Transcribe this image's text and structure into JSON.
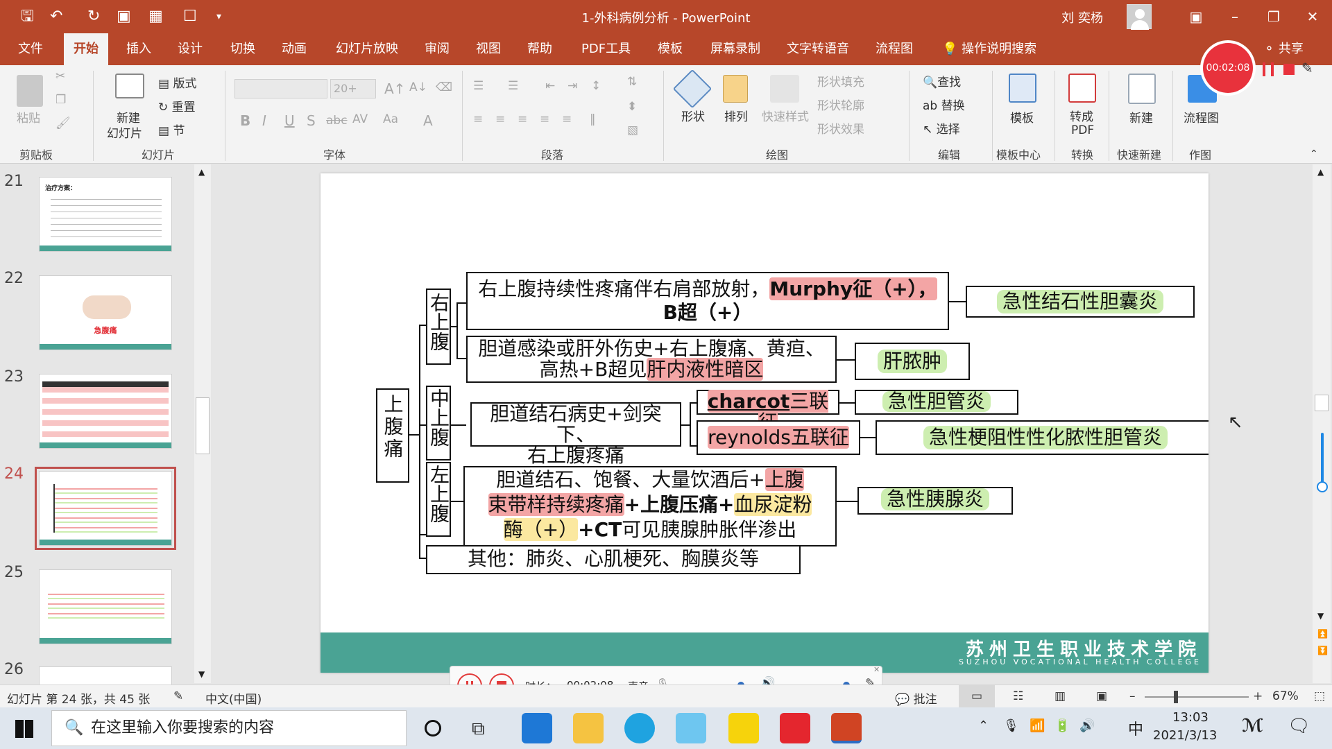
{
  "window": {
    "title": "1-外科病例分析  -  PowerPoint",
    "user": "刘 奕杨",
    "share": "共享"
  },
  "tabs": [
    "文件",
    "开始",
    "插入",
    "设计",
    "切换",
    "动画",
    "幻灯片放映",
    "审阅",
    "视图",
    "帮助",
    "PDF工具",
    "模板",
    "屏幕录制",
    "文字转语音",
    "流程图",
    "操作说明搜索"
  ],
  "ribbon": {
    "clipboard": {
      "paste": "粘贴",
      "label": "剪贴板"
    },
    "slides": {
      "new_slide": "新建",
      "new_slide2": "幻灯片",
      "layout": "版式",
      "reset": "重置",
      "section": "节",
      "label": "幻灯片"
    },
    "font": {
      "size": "20+",
      "label": "字体"
    },
    "paragraph": {
      "label": "段落"
    },
    "drawing": {
      "shape": "形状",
      "arrange": "排列",
      "quick_style": "快速样式",
      "fill": "形状填充",
      "outline": "形状轮廓",
      "effect": "形状效果",
      "label": "绘图"
    },
    "editing": {
      "find": "查找",
      "replace": "替换",
      "select": "选择",
      "label": "编辑"
    },
    "template": {
      "btn": "模板",
      "label": "模板中心"
    },
    "convert": {
      "btn": "转成",
      "btn2": "PDF",
      "label": "转换"
    },
    "quicknew": {
      "btn": "新建",
      "label": "快速新建"
    },
    "flow": {
      "btn": "流程图",
      "label": "作图"
    }
  },
  "recording": {
    "timer": "00:02:08"
  },
  "thumbnails": [
    {
      "num": "21",
      "title": "治疗方案："
    },
    {
      "num": "22",
      "title": "急腹痛"
    },
    {
      "num": "23"
    },
    {
      "num": "24"
    },
    {
      "num": "25"
    },
    {
      "num": "26"
    }
  ],
  "slide": {
    "root": "上腹痛",
    "regions": {
      "right": "右上腹",
      "middle": "中上腹",
      "left": "左上腹"
    },
    "b1": {
      "part1": "右上腹持续性疼痛伴右肩部放射，",
      "hl": "Murphy征（+），",
      "part2": "B超（+）"
    },
    "r1": "急性结石性胆囊炎",
    "b2": {
      "line1": "胆道感染或肝外伤史+右上腹痛、黄疸、",
      "line2a": "高热+B超见",
      "hl": "肝内液性暗区"
    },
    "r2": "肝脓肿",
    "b3": {
      "line1": "胆道结石病史+剑突下、",
      "line2": "右上腹疼痛"
    },
    "charcot": {
      "u": "charcot",
      "rest": "三联征"
    },
    "r3": "急性胆管炎",
    "reynolds": "reynolds五联征",
    "r4": "急性梗阻性性化脓性胆管炎",
    "b4": {
      "l1a": "胆道结石、饱餐、大量饮酒后+",
      "l1hl": "上腹",
      "l2hl": "束带样持续疼痛",
      "l2b": "+上腹压痛+",
      "l2hl2": "血尿淀粉",
      "l3hl": "酶（+）",
      "l3b": "+CT",
      "l3c": "可见胰腺肿胀伴渗出"
    },
    "r5": "急性胰腺炎",
    "other": "其他：肺炎、心肌梗死、胸膜炎等",
    "college_cn": "苏州卫生职业技术学院",
    "college_en": "SUZHOU VOCATIONAL   HEALTH COLLEGE"
  },
  "playback": {
    "duration_label": "时长：",
    "duration": "00:02:08",
    "sound_label": "声音"
  },
  "statusbar": {
    "slide_info": "幻灯片 第 24 张，共 45 张",
    "language": "中文(中国)",
    "comments": "批注",
    "zoom": "67%"
  },
  "taskbar": {
    "search_placeholder": "在这里输入你要搜索的内容",
    "ime": "中",
    "time": "13:03",
    "date": "2021/3/13"
  },
  "colors": {
    "accent": "#b7472a",
    "teal": "#4aa394",
    "highlight_red": "#f3a5a5",
    "highlight_yellow": "#fbe8a0",
    "result_green": "#cdeeb0",
    "record_red": "#e8323c"
  }
}
